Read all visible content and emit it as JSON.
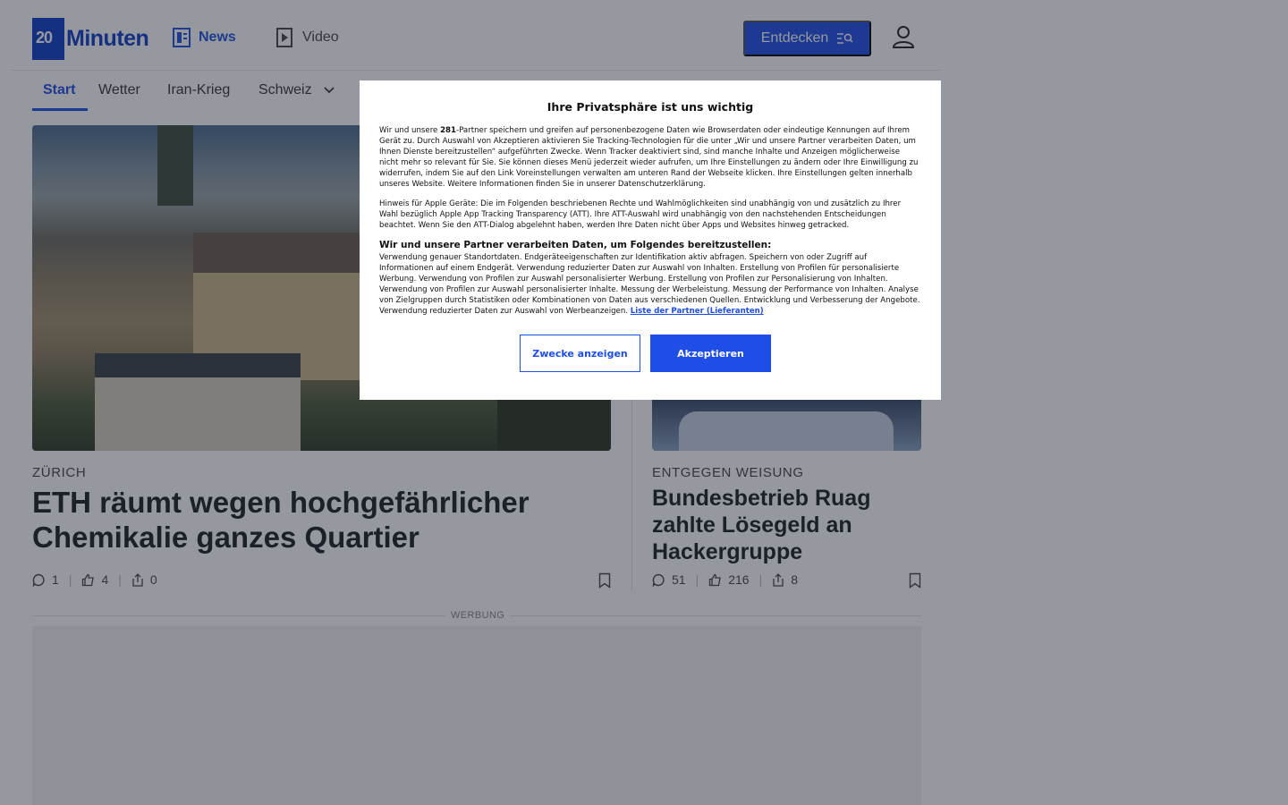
{
  "header": {
    "logo_text": "Minuten",
    "logo_mark": "20",
    "nav": [
      {
        "label": "News",
        "icon": "news-icon"
      },
      {
        "label": "Video",
        "icon": "video-icon"
      }
    ],
    "entdecken_label": "Entdecken"
  },
  "subnav": {
    "items": [
      "Start",
      "Wetter",
      "Iran-Krieg",
      "Schweiz"
    ]
  },
  "articles": [
    {
      "kicker": "ZÜRICH",
      "headline": "ETH räumt wegen hochgefährlicher Chemikalie ganzes Quartier",
      "comments": "1",
      "likes": "4",
      "shares": "0"
    },
    {
      "kicker": "ENTGEGEN WEISUNG",
      "headline": "Bundesbetrieb Ruag zahlte Lösegeld an Hackergruppe",
      "comments": "51",
      "likes": "216",
      "shares": "8"
    }
  ],
  "ad_label": "WERBUNG",
  "consent": {
    "title": "Ihre Privatsphäre ist uns wichtig",
    "p1_pre": "Wir und unsere ",
    "partner_count": "281",
    "p1_post": "-Partner speichern und greifen auf personenbezogene Daten wie Browserdaten oder eindeutige Kennungen auf Ihrem Gerät zu. Durch Auswahl von Akzeptieren aktivieren Sie Tracking-Technologien für die unter „Wir und unsere Partner verarbeiten Daten, um Ihnen Dienste bereitzustellen“ aufgeführten Zwecke. Wenn Tracker deaktiviert sind, sind manche Inhalte und Anzeigen möglicherweise nicht mehr so relevant für Sie. Sie können dieses Menü jederzeit wieder aufrufen, um Ihre Einstellungen zu ändern oder Ihre Einwilligung zu widerrufen, indem Sie auf den Link Voreinstellungen verwalten am unteren Rand der Webseite klicken. Ihre Einstellungen gelten innerhalb unseres Website. Weitere Informationen finden Sie in unserer Datenschutzerklärung.",
    "p2": "Hinweis für Apple Geräte: Die im Folgenden beschriebenen Rechte und Wahlmöglichkeiten sind unabhängig von und zusätzlich zu Ihrer Wahl bezüglich Apple App Tracking Transparency (ATT). Ihre ATT-Auswahl wird unabhängig von den nachstehenden Entscheidungen beachtet. Wenn Sie den ATT-Dialog abgelehnt haben, werden Ihre Daten nicht über Apps und Websites hinweg getracked.",
    "subtitle": "Wir und unsere Partner verarbeiten Daten, um Folgendes bereitzustellen:",
    "p3": "Verwendung genauer Standortdaten. Endgeräteeigenschaften zur Identifikation aktiv abfragen. Speichern von oder Zugriff auf Informationen auf einem Endgerät. Verwendung reduzierter Daten zur Auswahl von Inhalten. Erstellung von Profilen für personalisierte Werbung. Verwendung von Profilen zur Auswahl personalisierter Werbung. Erstellung von Profilen zur Personalisierung von Inhalten. Verwendung von Profilen zur Auswahl personalisierter Inhalte. Messung der Werbeleistung. Messung der Performance von Inhalten. Analyse von Zielgruppen durch Statistiken oder Kombinationen von Daten aus verschiedenen Quellen. Entwicklung und Verbesserung der Angebote. Verwendung reduzierter Daten zur Auswahl von Werbeanzeigen. ",
    "link": "Liste der Partner (Lieferanten)",
    "btn_purposes": "Zwecke anzeigen",
    "btn_accept": "Akzeptieren"
  },
  "colors": {
    "brand": "#0f3bc8",
    "accent": "#1e4de8",
    "overlay": "rgba(30,36,48,0.47)"
  }
}
